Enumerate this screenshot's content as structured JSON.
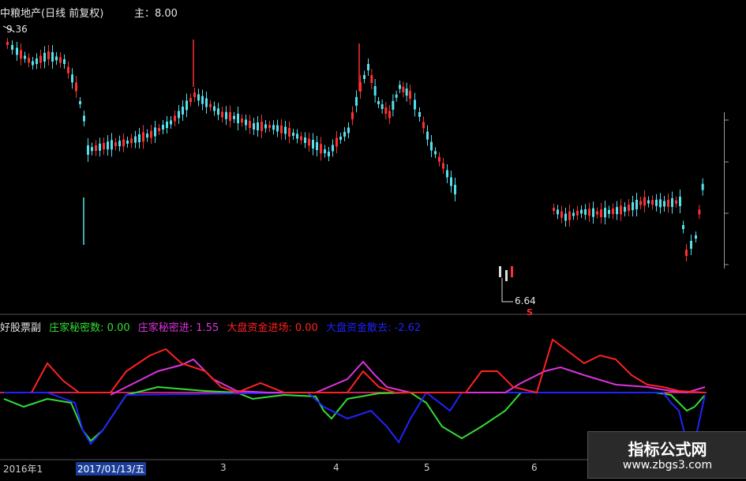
{
  "header": {
    "title": "中粮地产(日线 前复权)",
    "main_label": "主：8.00"
  },
  "price_markers": {
    "high": "9.36",
    "low": "6.64",
    "signal": "S"
  },
  "indicator": {
    "name": "好股票副",
    "items": [
      {
        "label": "庄家秘密数: 0.00",
        "color": "#33dd33"
      },
      {
        "label": "庄家秘密进: 1.55",
        "color": "#dd33dd"
      },
      {
        "label": "大盘资金进场: 0.00",
        "color": "#ff2222"
      },
      {
        "label": "大盘资金散去: -2.62",
        "color": "#2222ff"
      }
    ]
  },
  "x_axis": {
    "labels": [
      "2016年1",
      "2017/01/13/五",
      "3",
      "4",
      "5",
      "6"
    ]
  },
  "watermark": {
    "line1": "指标公式网",
    "line2": "www.zbgs3.com"
  },
  "colors": {
    "up_candle": "#ff3030",
    "down_candle": "#55e0ee",
    "zero_line_red": "#ff2222",
    "zero_line_blue": "#2222ff"
  }
}
